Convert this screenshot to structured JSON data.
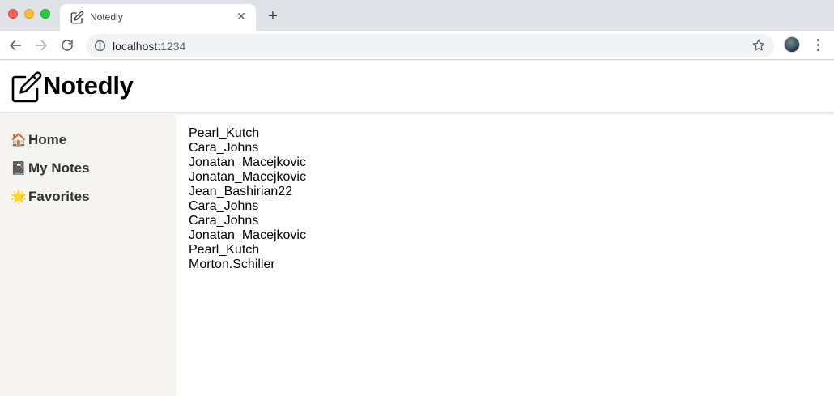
{
  "browser": {
    "tab_title": "Notedly",
    "url_host": "localhost:",
    "url_port": "1234"
  },
  "app": {
    "brand": "Notedly"
  },
  "sidebar": {
    "items": [
      {
        "icon": "house-icon",
        "emoji": "🏠",
        "label": "Home"
      },
      {
        "icon": "notebook-icon",
        "emoji": "📓",
        "label": "My Notes"
      },
      {
        "icon": "star-icon",
        "emoji": "🌟",
        "label": "Favorites"
      }
    ]
  },
  "main": {
    "authors": [
      "Pearl_Kutch",
      "Cara_Johns",
      "Jonatan_Macejkovic",
      "Jonatan_Macejkovic",
      "Jean_Bashirian22",
      "Cara_Johns",
      "Cara_Johns",
      "Jonatan_Macejkovic",
      "Pearl_Kutch",
      "Morton.Schiller"
    ]
  }
}
